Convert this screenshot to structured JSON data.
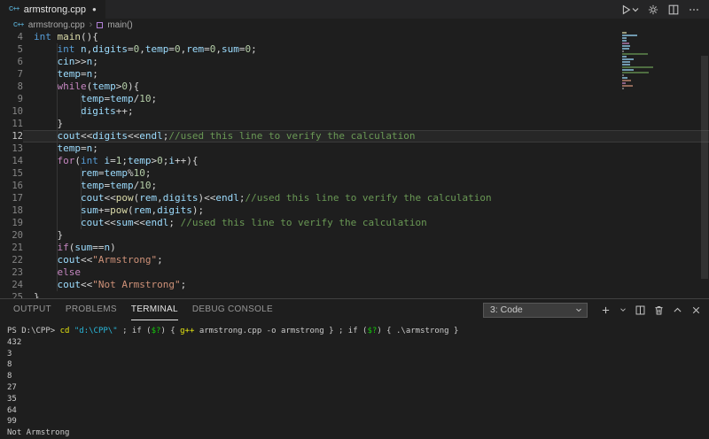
{
  "colors": {
    "background": "#1e1e1e",
    "tabbar_background": "#252526",
    "keyword": "#569cd6",
    "control_keyword": "#c586c0",
    "variable": "#9cdcfe",
    "number": "#b5cea8",
    "string": "#ce9178",
    "comment": "#6a9955",
    "function": "#dcdcaa",
    "plain_code": "#d4d4d4",
    "line_number": "#858585",
    "terminal_text": "#cccccc",
    "terminal_command": "#e5e510",
    "terminal_string": "#29b8db",
    "terminal_variable": "#16c60c",
    "file_icon": "#519aba",
    "symbol_icon": "#b180d7"
  },
  "tab_bar": {
    "tab_label": "armstrong.cpp",
    "modified": true,
    "actions": [
      "run",
      "settings",
      "split-editor",
      "more-actions"
    ]
  },
  "breadcrumb": {
    "file": "armstrong.cpp",
    "symbol": "main()"
  },
  "editor": {
    "current_line": 12,
    "lines": [
      {
        "n": 4,
        "t": [
          [
            "int",
            "kw"
          ],
          [
            " ",
            "pl"
          ],
          [
            "main",
            "fn"
          ],
          [
            "(){",
            "pl"
          ]
        ]
      },
      {
        "n": 5,
        "t": [
          [
            "    ",
            "pl"
          ],
          [
            "int",
            "kw"
          ],
          [
            " ",
            "pl"
          ],
          [
            "n",
            "vr"
          ],
          [
            ",",
            "pl"
          ],
          [
            "digits",
            "vr"
          ],
          [
            "=",
            "pl"
          ],
          [
            "0",
            "num"
          ],
          [
            ",",
            "pl"
          ],
          [
            "temp",
            "vr"
          ],
          [
            "=",
            "pl"
          ],
          [
            "0",
            "num"
          ],
          [
            ",",
            "pl"
          ],
          [
            "rem",
            "vr"
          ],
          [
            "=",
            "pl"
          ],
          [
            "0",
            "num"
          ],
          [
            ",",
            "pl"
          ],
          [
            "sum",
            "vr"
          ],
          [
            "=",
            "pl"
          ],
          [
            "0",
            "num"
          ],
          [
            ";",
            "pl"
          ]
        ]
      },
      {
        "n": 6,
        "t": [
          [
            "    ",
            "pl"
          ],
          [
            "cin",
            "vr"
          ],
          [
            ">>",
            "pl"
          ],
          [
            "n",
            "vr"
          ],
          [
            ";",
            "pl"
          ]
        ]
      },
      {
        "n": 7,
        "t": [
          [
            "    ",
            "pl"
          ],
          [
            "temp",
            "vr"
          ],
          [
            "=",
            "pl"
          ],
          [
            "n",
            "vr"
          ],
          [
            ";",
            "pl"
          ]
        ]
      },
      {
        "n": 8,
        "t": [
          [
            "    ",
            "pl"
          ],
          [
            "while",
            "ctrl"
          ],
          [
            "(",
            "pl"
          ],
          [
            "temp",
            "vr"
          ],
          [
            ">",
            "pl"
          ],
          [
            "0",
            "num"
          ],
          [
            "){",
            "pl"
          ]
        ]
      },
      {
        "n": 9,
        "t": [
          [
            "        ",
            "pl"
          ],
          [
            "temp",
            "vr"
          ],
          [
            "=",
            "pl"
          ],
          [
            "temp",
            "vr"
          ],
          [
            "/",
            "pl"
          ],
          [
            "10",
            "num"
          ],
          [
            ";",
            "pl"
          ]
        ]
      },
      {
        "n": 10,
        "t": [
          [
            "        ",
            "pl"
          ],
          [
            "digits",
            "vr"
          ],
          [
            "++;",
            "pl"
          ]
        ]
      },
      {
        "n": 11,
        "t": [
          [
            "    }",
            "pl"
          ]
        ]
      },
      {
        "n": 12,
        "t": [
          [
            "    ",
            "pl"
          ],
          [
            "cout",
            "vr"
          ],
          [
            "<<",
            "pl"
          ],
          [
            "digits",
            "vr"
          ],
          [
            "<<",
            "pl"
          ],
          [
            "endl",
            "vr"
          ],
          [
            ";",
            "pl"
          ],
          [
            "//used this line to verify the calculation",
            "com"
          ]
        ]
      },
      {
        "n": 13,
        "t": [
          [
            "    ",
            "pl"
          ],
          [
            "temp",
            "vr"
          ],
          [
            "=",
            "pl"
          ],
          [
            "n",
            "vr"
          ],
          [
            ";",
            "pl"
          ]
        ]
      },
      {
        "n": 14,
        "t": [
          [
            "    ",
            "pl"
          ],
          [
            "for",
            "ctrl"
          ],
          [
            "(",
            "pl"
          ],
          [
            "int",
            "kw"
          ],
          [
            " ",
            "pl"
          ],
          [
            "i",
            "vr"
          ],
          [
            "=",
            "pl"
          ],
          [
            "1",
            "num"
          ],
          [
            ";",
            "pl"
          ],
          [
            "temp",
            "vr"
          ],
          [
            ">",
            "pl"
          ],
          [
            "0",
            "num"
          ],
          [
            ";",
            "pl"
          ],
          [
            "i",
            "vr"
          ],
          [
            "++){",
            "pl"
          ]
        ]
      },
      {
        "n": 15,
        "t": [
          [
            "        ",
            "pl"
          ],
          [
            "rem",
            "vr"
          ],
          [
            "=",
            "pl"
          ],
          [
            "temp",
            "vr"
          ],
          [
            "%",
            "pl"
          ],
          [
            "10",
            "num"
          ],
          [
            ";",
            "pl"
          ]
        ]
      },
      {
        "n": 16,
        "t": [
          [
            "        ",
            "pl"
          ],
          [
            "temp",
            "vr"
          ],
          [
            "=",
            "pl"
          ],
          [
            "temp",
            "vr"
          ],
          [
            "/",
            "pl"
          ],
          [
            "10",
            "num"
          ],
          [
            ";",
            "pl"
          ]
        ]
      },
      {
        "n": 17,
        "t": [
          [
            "        ",
            "pl"
          ],
          [
            "cout",
            "vr"
          ],
          [
            "<<",
            "pl"
          ],
          [
            "pow",
            "fn"
          ],
          [
            "(",
            "pl"
          ],
          [
            "rem",
            "vr"
          ],
          [
            ",",
            "pl"
          ],
          [
            "digits",
            "vr"
          ],
          [
            ")",
            "pl"
          ],
          [
            "<<",
            "pl"
          ],
          [
            "endl",
            "vr"
          ],
          [
            ";",
            "pl"
          ],
          [
            "//used this line to verify the calculation",
            "com"
          ]
        ]
      },
      {
        "n": 18,
        "t": [
          [
            "        ",
            "pl"
          ],
          [
            "sum",
            "vr"
          ],
          [
            "+=",
            "pl"
          ],
          [
            "pow",
            "fn"
          ],
          [
            "(",
            "pl"
          ],
          [
            "rem",
            "vr"
          ],
          [
            ",",
            "pl"
          ],
          [
            "digits",
            "vr"
          ],
          [
            ");",
            "pl"
          ]
        ]
      },
      {
        "n": 19,
        "t": [
          [
            "        ",
            "pl"
          ],
          [
            "cout",
            "vr"
          ],
          [
            "<<",
            "pl"
          ],
          [
            "sum",
            "vr"
          ],
          [
            "<<",
            "pl"
          ],
          [
            "endl",
            "vr"
          ],
          [
            "; ",
            "pl"
          ],
          [
            "//used this line to verify the calculation",
            "com"
          ]
        ]
      },
      {
        "n": 20,
        "t": [
          [
            "    }",
            "pl"
          ]
        ]
      },
      {
        "n": 21,
        "t": [
          [
            "    ",
            "pl"
          ],
          [
            "if",
            "ctrl"
          ],
          [
            "(",
            "pl"
          ],
          [
            "sum",
            "vr"
          ],
          [
            "==",
            "pl"
          ],
          [
            "n",
            "vr"
          ],
          [
            ")",
            "pl"
          ]
        ]
      },
      {
        "n": 22,
        "t": [
          [
            "    ",
            "pl"
          ],
          [
            "cout",
            "vr"
          ],
          [
            "<<",
            "pl"
          ],
          [
            "\"Armstrong\"",
            "str"
          ],
          [
            ";",
            "pl"
          ]
        ]
      },
      {
        "n": 23,
        "t": [
          [
            "    ",
            "pl"
          ],
          [
            "else",
            "ctrl"
          ]
        ]
      },
      {
        "n": 24,
        "t": [
          [
            "    ",
            "pl"
          ],
          [
            "cout",
            "vr"
          ],
          [
            "<<",
            "pl"
          ],
          [
            "\"Not Armstrong\"",
            "str"
          ],
          [
            ";",
            "pl"
          ]
        ]
      },
      {
        "n": 25,
        "t": [
          [
            "}",
            "pl"
          ]
        ]
      }
    ]
  },
  "panel": {
    "tabs": [
      {
        "label": "OUTPUT",
        "active": false
      },
      {
        "label": "PROBLEMS",
        "active": false
      },
      {
        "label": "TERMINAL",
        "active": true
      },
      {
        "label": "DEBUG CONSOLE",
        "active": false
      }
    ],
    "terminal_select": "3: Code",
    "action_icons": [
      "new-terminal",
      "launch-profile",
      "split-terminal",
      "kill-terminal",
      "maximize-panel",
      "close-panel"
    ],
    "terminal_lines": [
      [
        [
          "PS D:\\CPP> ",
          "tpl"
        ],
        [
          "cd",
          "cmd"
        ],
        [
          " ",
          "tpl"
        ],
        [
          "\"d:\\CPP\\\"",
          "strt"
        ],
        [
          " ; ",
          "tpl"
        ],
        [
          "if",
          "tpl"
        ],
        [
          " (",
          "tpl"
        ],
        [
          "$?",
          "vart"
        ],
        [
          ") { ",
          "tpl"
        ],
        [
          "g++",
          "cmd"
        ],
        [
          " armstrong.cpp -o armstrong } ; ",
          "tpl"
        ],
        [
          "if",
          "tpl"
        ],
        [
          " (",
          "tpl"
        ],
        [
          "$?",
          "vart"
        ],
        [
          ") { .\\armstrong }",
          "tpl"
        ]
      ],
      [
        [
          "432",
          "tpl"
        ]
      ],
      [
        [
          "3",
          "tpl"
        ]
      ],
      [
        [
          "8",
          "tpl"
        ]
      ],
      [
        [
          "8",
          "tpl"
        ]
      ],
      [
        [
          "27",
          "tpl"
        ]
      ],
      [
        [
          "35",
          "tpl"
        ]
      ],
      [
        [
          "64",
          "tpl"
        ]
      ],
      [
        [
          "99",
          "tpl"
        ]
      ],
      [
        [
          "Not Armstrong",
          "tpl"
        ]
      ]
    ]
  }
}
